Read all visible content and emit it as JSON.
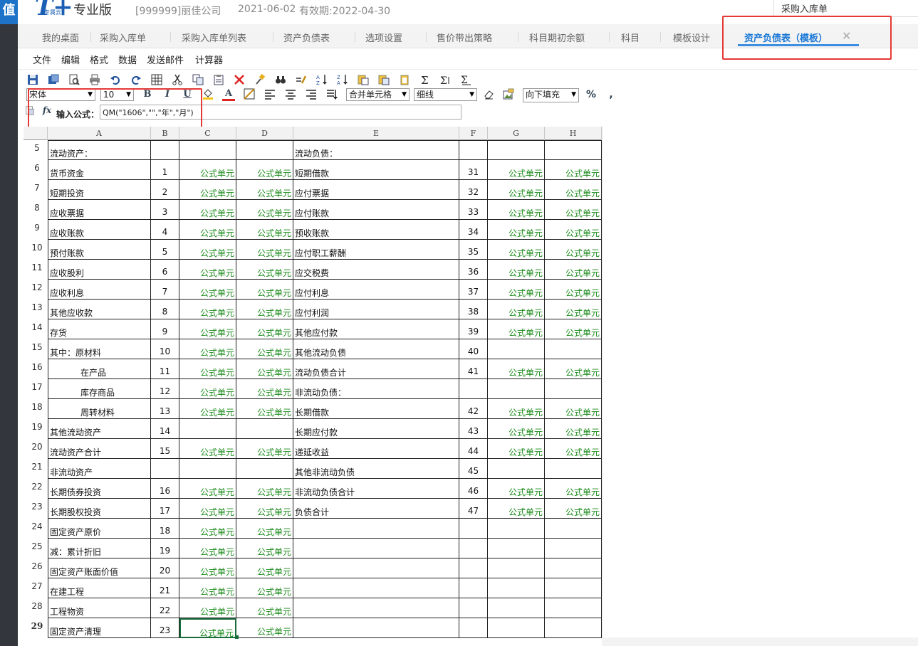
{
  "brand": {
    "logo_text": "T+",
    "logo_sub": "专属云",
    "edition": "专业版",
    "rail_glyph": "值"
  },
  "header": {
    "company": "[999999]丽佳公司",
    "date": "2021-06-02",
    "validity": "有效期:2022-04-30",
    "quick_search": "采购入库单"
  },
  "tabs": [
    {
      "label": "我的桌面"
    },
    {
      "label": "采购入库单"
    },
    {
      "label": "采购入库单列表"
    },
    {
      "label": "资产负债表"
    },
    {
      "label": "选项设置"
    },
    {
      "label": "售价带出策略"
    },
    {
      "label": "科目期初余额"
    },
    {
      "label": "科目"
    },
    {
      "label": "模板设计"
    },
    {
      "label": "资产负债表（模板）",
      "active": true
    }
  ],
  "tab_close_glyph": "✕",
  "menu": [
    "文件",
    "编辑",
    "格式",
    "数据",
    "发送邮件",
    "计算器"
  ],
  "toolbar": {
    "font_name": "宋体",
    "font_size": "10",
    "bold": "B",
    "italic": "I",
    "underline": "U",
    "font_color": "A",
    "merge_cells": "合并单元格",
    "border_style": "细线",
    "fill_direction": "向下填充",
    "percent": "%",
    "comma": ","
  },
  "formula": {
    "label": "输入公式：",
    "fx_glyph": "fx",
    "value": "QM(\"1606\",\"\",\"年\",\"月\")"
  },
  "columns": [
    "A",
    "B",
    "C",
    "D",
    "E",
    "F",
    "G",
    "H"
  ],
  "sheet_rows": [
    {
      "n": "5",
      "a": "流动资产：",
      "b": "",
      "c": "",
      "d": "",
      "e": "流动负债：",
      "f": "",
      "g": "",
      "h": ""
    },
    {
      "n": "6",
      "a": "货币资金",
      "b": "1",
      "c": "公式单元",
      "d": "公式单元",
      "e": "短期借款",
      "f": "31",
      "g": "公式单元",
      "h": "公式单元"
    },
    {
      "n": "7",
      "a": "短期投资",
      "b": "2",
      "c": "公式单元",
      "d": "公式单元",
      "e": "应付票据",
      "f": "32",
      "g": "公式单元",
      "h": "公式单元"
    },
    {
      "n": "8",
      "a": "应收票据",
      "b": "3",
      "c": "公式单元",
      "d": "公式单元",
      "e": "应付账款",
      "f": "33",
      "g": "公式单元",
      "h": "公式单元"
    },
    {
      "n": "9",
      "a": "应收账款",
      "b": "4",
      "c": "公式单元",
      "d": "公式单元",
      "e": "预收账款",
      "f": "34",
      "g": "公式单元",
      "h": "公式单元"
    },
    {
      "n": "10",
      "a": "预付账款",
      "b": "5",
      "c": "公式单元",
      "d": "公式单元",
      "e": "应付职工薪酬",
      "f": "35",
      "g": "公式单元",
      "h": "公式单元"
    },
    {
      "n": "11",
      "a": "应收股利",
      "b": "6",
      "c": "公式单元",
      "d": "公式单元",
      "e": "应交税费",
      "f": "36",
      "g": "公式单元",
      "h": "公式单元"
    },
    {
      "n": "12",
      "a": "应收利息",
      "b": "7",
      "c": "公式单元",
      "d": "公式单元",
      "e": "应付利息",
      "f": "37",
      "g": "公式单元",
      "h": "公式单元"
    },
    {
      "n": "13",
      "a": "其他应收款",
      "b": "8",
      "c": "公式单元",
      "d": "公式单元",
      "e": "应付利润",
      "f": "38",
      "g": "公式单元",
      "h": "公式单元"
    },
    {
      "n": "14",
      "a": "存货",
      "b": "9",
      "c": "公式单元",
      "d": "公式单元",
      "e": "其他应付款",
      "f": "39",
      "g": "公式单元",
      "h": "公式单元"
    },
    {
      "n": "15",
      "a": "其中：原材料",
      "b": "10",
      "c": "公式单元",
      "d": "公式单元",
      "e": "其他流动负债",
      "f": "40",
      "g": "",
      "h": ""
    },
    {
      "n": "16",
      "a": "在产品",
      "indent": true,
      "b": "11",
      "c": "公式单元",
      "d": "公式单元",
      "e": "流动负债合计",
      "f": "41",
      "g": "公式单元",
      "h": "公式单元"
    },
    {
      "n": "17",
      "a": "库存商品",
      "indent": true,
      "b": "12",
      "c": "公式单元",
      "d": "公式单元",
      "e": "非流动负债：",
      "f": "",
      "g": "",
      "h": ""
    },
    {
      "n": "18",
      "a": "周转材料",
      "indent": true,
      "b": "13",
      "c": "公式单元",
      "d": "公式单元",
      "e": "长期借款",
      "f": "42",
      "g": "公式单元",
      "h": "公式单元"
    },
    {
      "n": "19",
      "a": "其他流动资产",
      "b": "14",
      "c": "",
      "d": "",
      "e": "长期应付款",
      "f": "43",
      "g": "公式单元",
      "h": "公式单元"
    },
    {
      "n": "20",
      "a": "流动资产合计",
      "b": "15",
      "c": "公式单元",
      "d": "公式单元",
      "e": "递延收益",
      "f": "44",
      "g": "公式单元",
      "h": "公式单元"
    },
    {
      "n": "21",
      "a": "非流动资产",
      "b": "",
      "c": "",
      "d": "",
      "e": "其他非流动负债",
      "f": "45",
      "g": "",
      "h": ""
    },
    {
      "n": "22",
      "a": "长期债券投资",
      "b": "16",
      "c": "公式单元",
      "d": "公式单元",
      "e": "非流动负债合计",
      "f": "46",
      "g": "公式单元",
      "h": "公式单元"
    },
    {
      "n": "23",
      "a": "长期股权投资",
      "b": "17",
      "c": "公式单元",
      "d": "公式单元",
      "e": "负债合计",
      "f": "47",
      "g": "公式单元",
      "h": "公式单元"
    },
    {
      "n": "24",
      "a": "固定资产原价",
      "b": "18",
      "c": "公式单元",
      "d": "公式单元",
      "e": "",
      "f": "",
      "g": "",
      "h": ""
    },
    {
      "n": "25",
      "a": "减：累计折旧",
      "b": "19",
      "c": "公式单元",
      "d": "公式单元",
      "e": "",
      "f": "",
      "g": "",
      "h": ""
    },
    {
      "n": "26",
      "a": "固定资产账面价值",
      "b": "20",
      "c": "公式单元",
      "d": "公式单元",
      "e": "",
      "f": "",
      "g": "",
      "h": ""
    },
    {
      "n": "27",
      "a": "在建工程",
      "b": "21",
      "c": "公式单元",
      "d": "公式单元",
      "e": "",
      "f": "",
      "g": "",
      "h": ""
    },
    {
      "n": "28",
      "a": "工程物资",
      "b": "22",
      "c": "公式单元",
      "d": "公式单元",
      "e": "",
      "f": "",
      "g": "",
      "h": ""
    },
    {
      "n": "29",
      "a": "固定资产清理",
      "b": "23",
      "c": "公式单元",
      "d": "公式单元",
      "e": "",
      "f": "",
      "g": "",
      "h": "",
      "selected_row": true
    }
  ],
  "colors": {
    "accent": "#1a78d6",
    "formula_cell": "#1a8a1a",
    "highlight": "#e53935",
    "selection": "#1a6b3a"
  }
}
